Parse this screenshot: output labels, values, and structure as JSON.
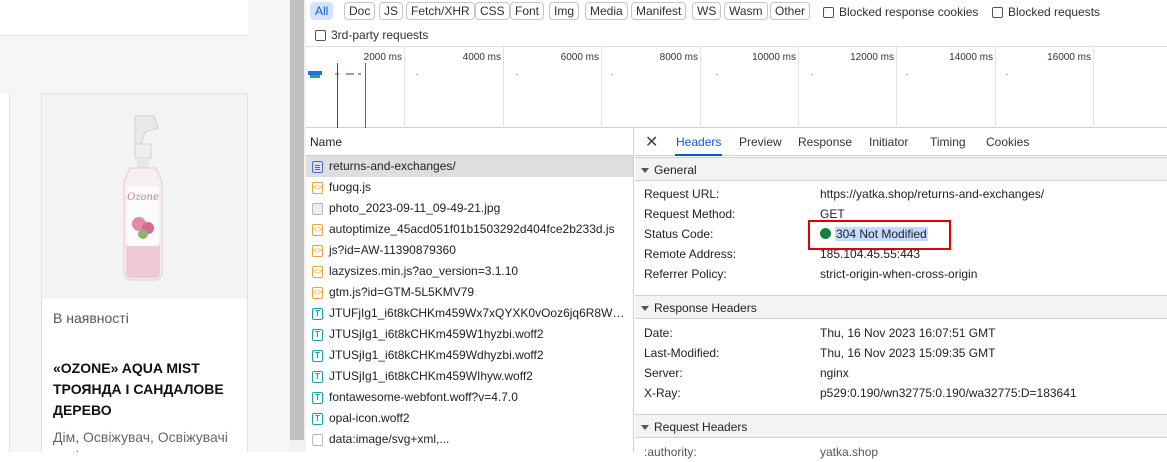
{
  "site": {
    "availability": "В наявності",
    "product_title": "«OZONE» AQUA MIST ТРОЯНДА І САНДАЛОВЕ ДЕРЕВО",
    "categories": "Дім, Освіжувач, Освіжувачі повітря"
  },
  "filters": {
    "types": [
      "All",
      "Doc",
      "JS",
      "Fetch/XHR",
      "CSS",
      "Font",
      "Img",
      "Media",
      "Manifest",
      "WS",
      "Wasm",
      "Other"
    ],
    "active": "All",
    "blocked_cookies": "Blocked response cookies",
    "blocked_requests": "Blocked requests",
    "third_party": "3rd-party requests"
  },
  "timeline": {
    "labels": [
      "2000 ms",
      "4000 ms",
      "6000 ms",
      "8000 ms",
      "10000 ms",
      "12000 ms",
      "14000 ms",
      "16000 ms"
    ]
  },
  "request_list": {
    "header": "Name",
    "rows": [
      {
        "name": "returns-and-exchanges/",
        "type": "doc"
      },
      {
        "name": "fuogq.js",
        "type": "js"
      },
      {
        "name": "photo_2023-09-11_09-49-21.jpg",
        "type": "img"
      },
      {
        "name": "autoptimize_45acd051f01b1503292d404fce2b233d.js",
        "type": "js"
      },
      {
        "name": "js?id=AW-11390879360",
        "type": "js"
      },
      {
        "name": "lazysizes.min.js?ao_version=3.1.10",
        "type": "js"
      },
      {
        "name": "gtm.js?id=GTM-5L5KMV79",
        "type": "js"
      },
      {
        "name": "JTUFjIg1_i6t8kCHKm459Wx7xQYXK0vOoz6jq6R8WX...",
        "type": "font"
      },
      {
        "name": "JTUSjIg1_i6t8kCHKm459W1hyzbi.woff2",
        "type": "font"
      },
      {
        "name": "JTUSjIg1_i6t8kCHKm459Wdhyzbi.woff2",
        "type": "font"
      },
      {
        "name": "JTUSjIg1_i6t8kCHKm459WIhyw.woff2",
        "type": "font"
      },
      {
        "name": "fontawesome-webfont.woff?v=4.7.0",
        "type": "font"
      },
      {
        "name": "opal-icon.woff2",
        "type": "font"
      },
      {
        "name": "data:image/svg+xml,...",
        "type": "data"
      }
    ]
  },
  "details": {
    "tabs": [
      "Headers",
      "Preview",
      "Response",
      "Initiator",
      "Timing",
      "Cookies"
    ],
    "active_tab": "Headers",
    "general": {
      "title": "General",
      "rows": [
        {
          "key": "Request URL:",
          "value": "https://yatka.shop/returns-and-exchanges/"
        },
        {
          "key": "Request Method:",
          "value": "GET"
        },
        {
          "key": "Status Code:",
          "value": "304 Not Modified"
        },
        {
          "key": "Remote Address:",
          "value": "185.104.45.55:443"
        },
        {
          "key": "Referrer Policy:",
          "value": "strict-origin-when-cross-origin"
        }
      ]
    },
    "response_headers": {
      "title": "Response Headers",
      "rows": [
        {
          "key": "Date:",
          "value": "Thu, 16 Nov 2023 16:07:51 GMT"
        },
        {
          "key": "Last-Modified:",
          "value": "Thu, 16 Nov 2023 15:09:35 GMT"
        },
        {
          "key": "Server:",
          "value": "nginx"
        },
        {
          "key": "X-Ray:",
          "value": "p529:0.190/wn32775:0.190/wa32775:D=183641"
        }
      ]
    },
    "request_headers": {
      "title": "Request Headers",
      "partial_key": ":authority:",
      "partial_value": "yatka.shop"
    }
  },
  "colors": {
    "accent": "#0b57d0",
    "status_ok": "#188038",
    "highlight_box": "#e00000"
  }
}
